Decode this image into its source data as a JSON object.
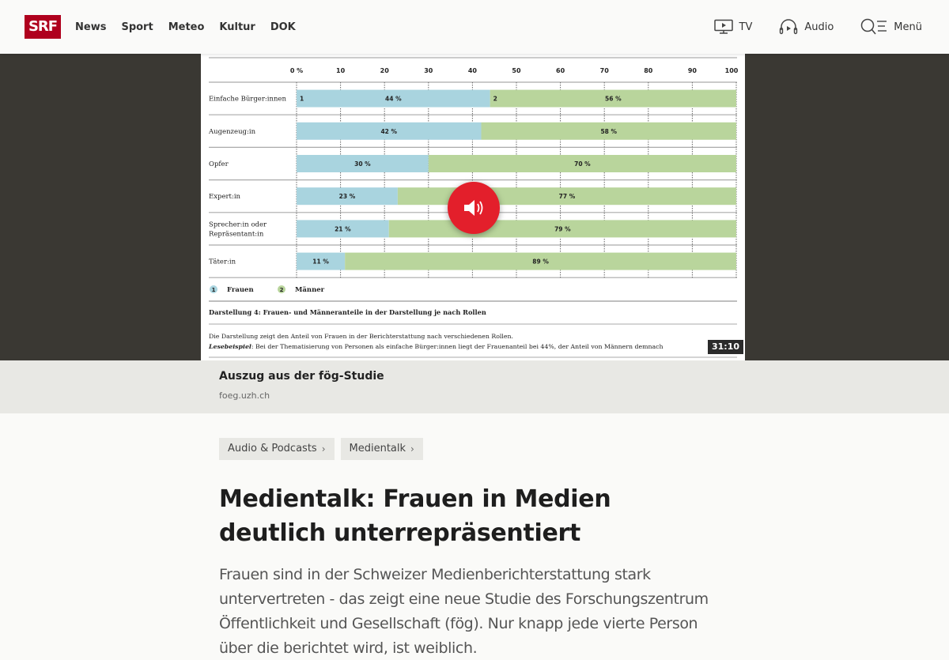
{
  "header": {
    "logo": "SRF",
    "nav": [
      "News",
      "Sport",
      "Meteo",
      "Kultur",
      "DOK"
    ],
    "right_nav": [
      {
        "label": "TV",
        "icon": "tv-icon"
      },
      {
        "label": "Audio",
        "icon": "headphones-icon"
      },
      {
        "label": "Menü",
        "icon": "search-menu-icon"
      }
    ]
  },
  "media": {
    "duration": "31:10",
    "play_icon": "speaker-icon"
  },
  "chart_data": {
    "type": "bar",
    "stacked": true,
    "orientation": "horizontal",
    "categories": [
      "Einfache Bürger:innen",
      "Augenzeug:in",
      "Opfer",
      "Expert:in",
      "Sprecher:in oder Repräsentant:in",
      "Täter:in"
    ],
    "category_lines": [
      [
        "Einfache Bürger:innen"
      ],
      [
        "Augenzeug:in"
      ],
      [
        "Opfer"
      ],
      [
        "Expert:in"
      ],
      [
        "Sprecher:in oder",
        "Repräsentant:in"
      ],
      [
        "Täter:in"
      ]
    ],
    "series": [
      {
        "name": "Frauen",
        "marker": "1",
        "color": "#a9d4df",
        "values": [
          44,
          42,
          30,
          23,
          21,
          11
        ]
      },
      {
        "name": "Männer",
        "marker": "2",
        "color": "#b9d59c",
        "values": [
          56,
          58,
          70,
          77,
          79,
          89
        ]
      }
    ],
    "first_row_markers": [
      "1",
      "2"
    ],
    "x_ticks": [
      "0 %",
      "10",
      "20",
      "30",
      "40",
      "50",
      "60",
      "70",
      "80",
      "90",
      "100"
    ],
    "xlim": [
      0,
      100
    ],
    "value_suffix": " %",
    "grid": "dotted vertical",
    "legend": "bottom-left",
    "title": "Darstellung 4: Frauen- und Männeranteile in der Darstellung je nach Rollen",
    "description_line1": "Die Darstellung zeigt den Anteil von Frauen in der Berichterstattung nach verschiedenen Rollen.",
    "description_label": "Lesebeispiel",
    "description_line2": ": Bei der Thematisierung von Personen als einfache Bürger:innen liegt der Frauenanteil bei 44%, der Anteil von Männern demnach"
  },
  "caption": {
    "title": "Auszug aus der fög-Studie",
    "source": "foeg.uzh.ch"
  },
  "breadcrumbs": [
    {
      "label": "Audio & Podcasts"
    },
    {
      "label": "Medientalk"
    }
  ],
  "article": {
    "title": "Medientalk: Frauen in Medien deutlich unterrepräsentiert",
    "lead": "Frauen sind in der Schweizer Medienberichterstattung stark untervertreten - das zeigt eine neue Studie des Forschungszentrum Öffentlichkeit und Gesellschaft (fög). Nur knapp jede vierte Person über die berichtet wird, ist weiblich."
  }
}
